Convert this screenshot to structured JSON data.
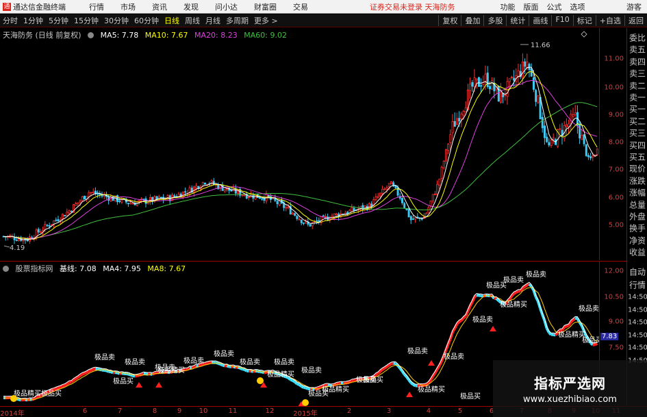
{
  "menubar": {
    "app_title": "通达信金融终端",
    "items": [
      "行情",
      "市场",
      "资讯",
      "发现",
      "问小达",
      "财富圈",
      "交易"
    ],
    "status": "证券交易未登录  天海防务",
    "right_items": [
      "功能",
      "版面",
      "公式",
      "选项"
    ],
    "guest": "游客"
  },
  "toolbar": {
    "periods": [
      "分时",
      "1分钟",
      "5分钟",
      "15分钟",
      "30分钟",
      "60分钟",
      "日线",
      "周线",
      "月线",
      "多周期",
      "更多 >"
    ],
    "active_period": "日线",
    "buttons": [
      "复权",
      "叠加",
      "多股",
      "统计",
      "画线",
      "F10",
      "标记",
      "+自选",
      "返回"
    ]
  },
  "main_chart": {
    "title": "天海防务 (日线 前复权)",
    "ma5": "MA5: 7.78",
    "ma10": "MA10: 7.67",
    "ma20": "MA20: 8.23",
    "ma60": "MA60: 9.02",
    "high_label": "11.66",
    "low_label": "4.19",
    "ticks": [
      "11.00",
      "10.00",
      "9.00",
      "8.00",
      "7.00",
      "6.00",
      "5.00"
    ]
  },
  "indicator": {
    "title": "股票指标网",
    "base": "基线: 7.08",
    "ma4": "MA4: 7.95",
    "ma8": "MA8: 7.67",
    "ticks": [
      "12.00",
      "10.50",
      "9.00",
      "7.50"
    ],
    "current": "7.83",
    "label_sell": "极品卖",
    "label_buy": "极品买",
    "label_precise": "极品精买"
  },
  "sidepanel": {
    "items": [
      "委比",
      "卖五",
      "卖四",
      "卖三",
      "卖二",
      "卖一",
      "买一",
      "买二",
      "买三",
      "买四",
      "买五",
      "现价",
      "涨跌",
      "涨幅",
      "总量",
      "外盘",
      "换手",
      "净资",
      "收益"
    ],
    "items2": [
      "自动",
      "行情",
      "14:50",
      "14:50",
      "14:50",
      "14:50",
      "14:50",
      "14:50"
    ]
  },
  "date_axis": {
    "labels": [
      "2014年",
      "6",
      "7",
      "8",
      "9",
      "10",
      "11",
      "12",
      "2015年",
      "2",
      "3",
      "4",
      "5",
      "6",
      "7",
      "8",
      "9",
      "10",
      "11"
    ]
  },
  "watermark": {
    "title": "指标严选网",
    "url": "www.xuezhibiao.com"
  },
  "colors": {
    "up": "#ff3030",
    "down": "#3cc8f0",
    "ma5": "#ffffff",
    "ma10": "#ffff00",
    "ma20": "#e040e0",
    "ma60": "#40c040",
    "axis": "#a00000"
  }
}
